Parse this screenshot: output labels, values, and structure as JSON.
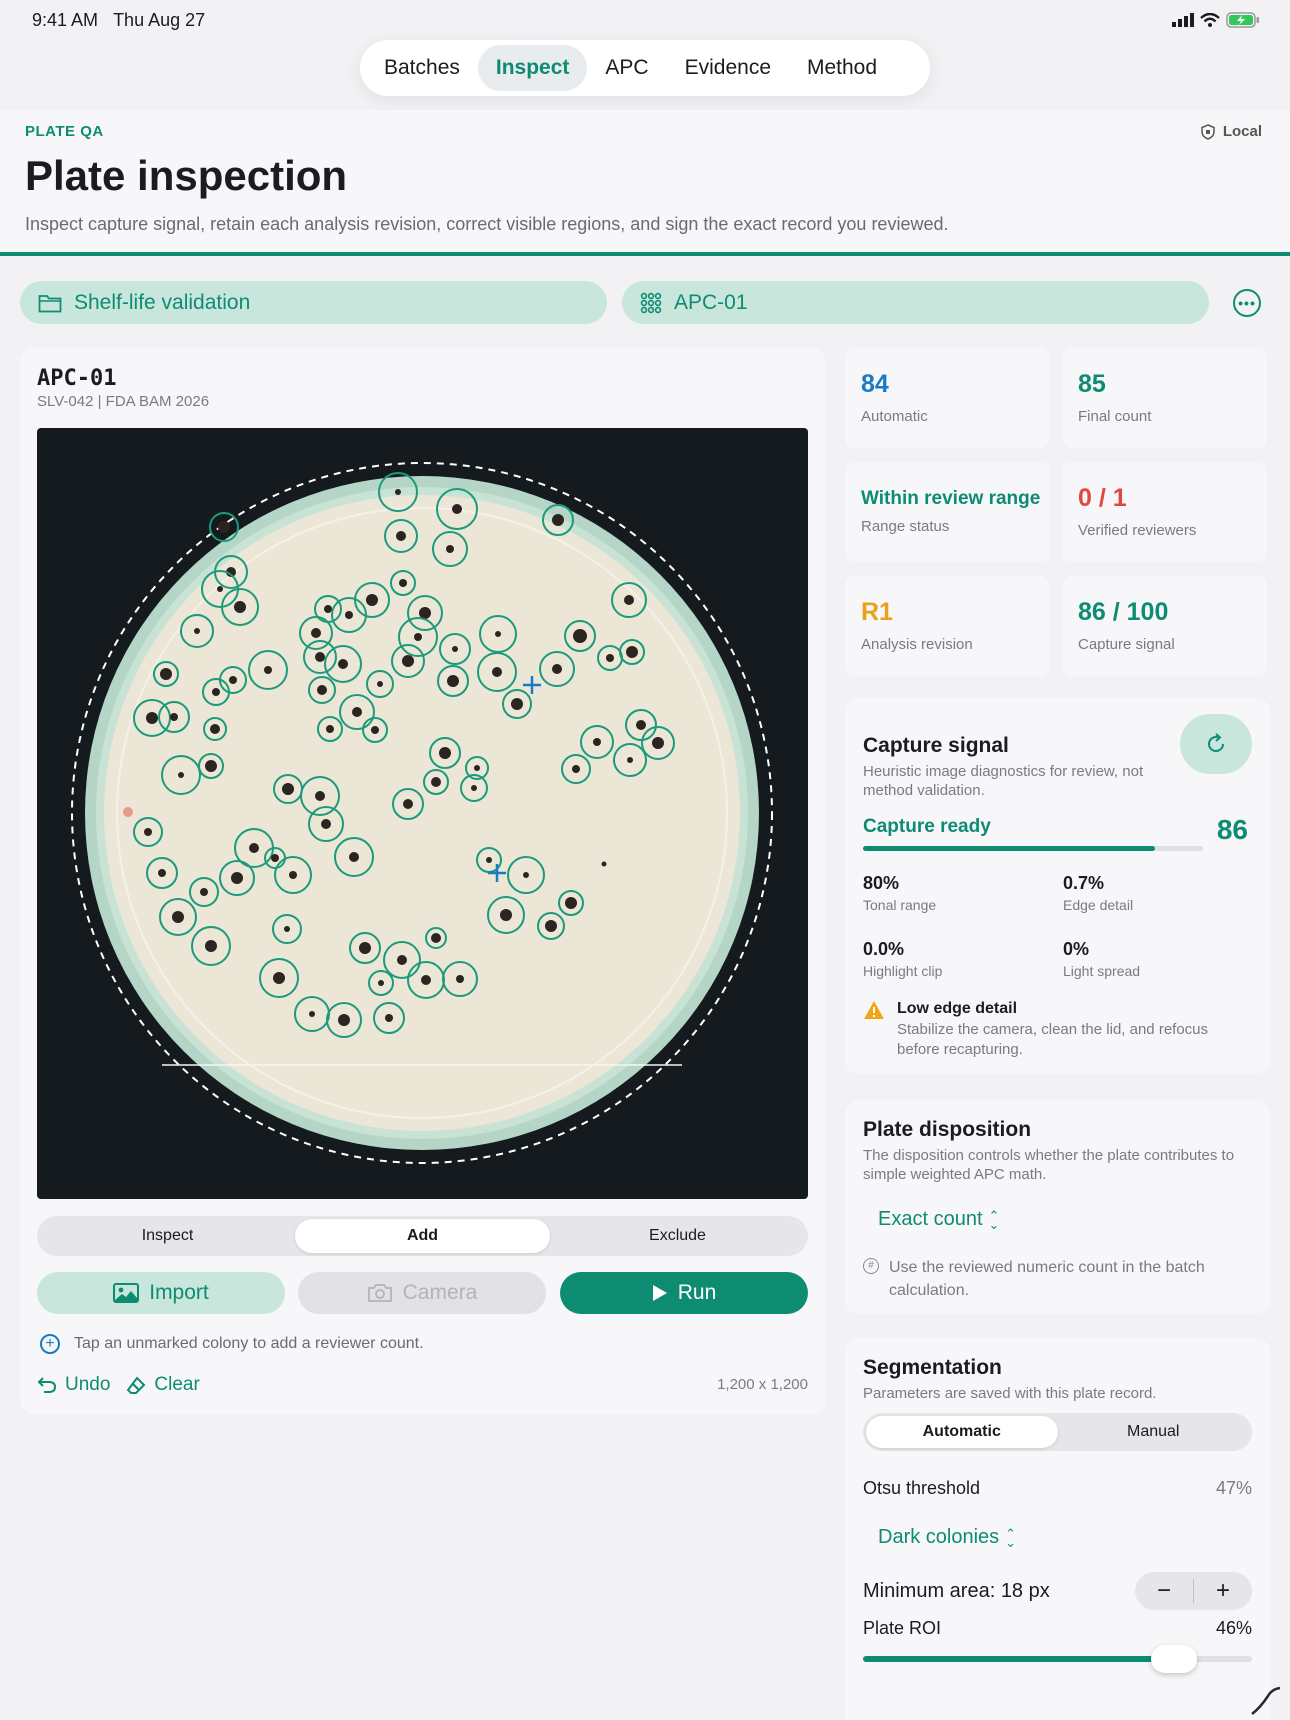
{
  "status": {
    "time": "9:41 AM",
    "date": "Thu Aug 27"
  },
  "nav": {
    "tabs": [
      {
        "label": "Batches"
      },
      {
        "label": "Inspect"
      },
      {
        "label": "APC"
      },
      {
        "label": "Evidence"
      },
      {
        "label": "Method"
      }
    ],
    "active": "Inspect"
  },
  "header": {
    "eyebrow": "PLATE QA",
    "local": "Local",
    "title": "Plate inspection",
    "subtitle": "Inspect capture signal, retain each analysis revision, correct visible regions, and sign the exact record you reviewed."
  },
  "pickers": {
    "study": "Shelf-life validation",
    "plate": "APC-01"
  },
  "plate": {
    "id": "APC-01",
    "meta": "SLV-042  |  FDA BAM 2026",
    "modes": [
      "Inspect",
      "Add",
      "Exclude"
    ],
    "active_mode": "Add",
    "buttons": {
      "import": "Import",
      "camera": "Camera",
      "run": "Run"
    },
    "hint": "Tap an unmarked colony to add a reviewer count.",
    "undo": "Undo",
    "clear": "Clear",
    "dimensions": "1,200 x 1,200"
  },
  "stats": [
    {
      "value": "84",
      "label": "Automatic",
      "color": "#1a7ac4"
    },
    {
      "value": "85",
      "label": "Final count",
      "color": "#0d8c72"
    },
    {
      "value": "Within review range",
      "label": "Range status",
      "color": "#0d8c72"
    },
    {
      "value": "0 / 1",
      "label": "Verified reviewers",
      "color": "#e0483e"
    },
    {
      "value": "R1",
      "label": "Analysis revision",
      "color": "#e8a21a"
    },
    {
      "value": "86 / 100",
      "label": "Capture signal",
      "color": "#0d8c72"
    }
  ],
  "capture": {
    "title": "Capture signal",
    "desc": "Heuristic image diagnostics for review, not method validation.",
    "status": "Capture ready",
    "score": "86",
    "progress": 0.86,
    "metrics": [
      {
        "value": "80%",
        "label": "Tonal range"
      },
      {
        "value": "0.7%",
        "label": "Edge detail"
      },
      {
        "value": "0.0%",
        "label": "Highlight clip"
      },
      {
        "value": "0%",
        "label": "Light spread"
      }
    ],
    "warning_title": "Low edge detail",
    "warning_desc": "Stabilize the camera, clean the lid, and refocus before recapturing."
  },
  "disposition": {
    "title": "Plate disposition",
    "desc": "The disposition controls whether the plate contributes to simple weighted APC math.",
    "value": "Exact count",
    "note": "Use the reviewed numeric count in the batch calculation."
  },
  "segmentation": {
    "title": "Segmentation",
    "desc": "Parameters are saved with this plate record.",
    "modes": [
      "Automatic",
      "Manual"
    ],
    "active_mode": "Automatic",
    "otsu_label": "Otsu threshold",
    "otsu_value": "47%",
    "polarity": "Dark colonies",
    "min_area": "Minimum area: 18 px",
    "roi_label": "Plate ROI",
    "roi_value": "46%",
    "roi_fraction": 0.8
  },
  "colonies": [
    [
      398,
      492,
      19,
      3
    ],
    [
      224,
      527,
      14,
      6
    ],
    [
      457,
      509,
      20,
      5
    ],
    [
      401,
      536,
      16,
      5
    ],
    [
      450,
      549,
      17,
      4
    ],
    [
      558,
      520,
      15,
      6
    ],
    [
      231,
      572,
      16,
      5
    ],
    [
      220,
      589,
      18,
      3
    ],
    [
      240,
      607,
      18,
      6
    ],
    [
      403,
      583,
      12,
      4
    ],
    [
      372,
      600,
      17,
      6
    ],
    [
      328,
      609,
      13,
      4
    ],
    [
      349,
      615,
      17,
      4
    ],
    [
      425,
      613,
      17,
      6
    ],
    [
      197,
      631,
      16,
      3
    ],
    [
      316,
      633,
      16,
      5
    ],
    [
      418,
      637,
      19,
      4
    ],
    [
      498,
      634,
      18,
      3
    ],
    [
      580,
      636,
      15,
      7
    ],
    [
      629,
      600,
      17,
      5
    ],
    [
      455,
      649,
      15,
      3
    ],
    [
      320,
      657,
      16,
      5
    ],
    [
      343,
      664,
      18,
      5
    ],
    [
      408,
      661,
      16,
      6
    ],
    [
      453,
      681,
      15,
      6
    ],
    [
      497,
      672,
      19,
      5
    ],
    [
      557,
      669,
      17,
      5
    ],
    [
      610,
      658,
      12,
      4
    ],
    [
      632,
      652,
      12,
      6
    ],
    [
      166,
      674,
      12,
      6
    ],
    [
      233,
      680,
      13,
      4
    ],
    [
      268,
      670,
      19,
      4
    ],
    [
      216,
      692,
      13,
      4
    ],
    [
      322,
      690,
      13,
      5
    ],
    [
      380,
      684,
      13,
      3
    ],
    [
      152,
      718,
      18,
      6
    ],
    [
      174,
      717,
      15,
      4
    ],
    [
      215,
      729,
      11,
      5
    ],
    [
      357,
      712,
      17,
      5
    ],
    [
      330,
      729,
      12,
      4
    ],
    [
      375,
      730,
      12,
      4
    ],
    [
      517,
      704,
      14,
      6
    ],
    [
      641,
      725,
      15,
      5
    ],
    [
      658,
      743,
      16,
      6
    ],
    [
      597,
      742,
      16,
      4
    ],
    [
      630,
      760,
      16,
      3
    ],
    [
      576,
      769,
      14,
      4
    ],
    [
      445,
      753,
      15,
      6
    ],
    [
      477,
      768,
      11,
      3
    ],
    [
      436,
      782,
      12,
      5
    ],
    [
      474,
      788,
      13,
      3
    ],
    [
      181,
      775,
      19,
      3
    ],
    [
      211,
      766,
      12,
      6
    ],
    [
      288,
      789,
      14,
      6
    ],
    [
      320,
      796,
      19,
      5
    ],
    [
      326,
      824,
      17,
      5
    ],
    [
      408,
      804,
      15,
      5
    ],
    [
      148,
      832,
      14,
      4
    ],
    [
      254,
      848,
      19,
      5
    ],
    [
      275,
      858,
      10,
      4
    ],
    [
      354,
      857,
      19,
      5
    ],
    [
      162,
      873,
      15,
      4
    ],
    [
      237,
      878,
      17,
      6
    ],
    [
      293,
      875,
      18,
      4
    ],
    [
      489,
      860,
      12,
      3
    ],
    [
      526,
      875,
      18,
      3
    ],
    [
      204,
      892,
      14,
      4
    ],
    [
      178,
      917,
      18,
      6
    ],
    [
      506,
      915,
      18,
      6
    ],
    [
      571,
      903,
      12,
      6
    ],
    [
      551,
      926,
      13,
      6
    ],
    [
      287,
      929,
      14,
      3
    ],
    [
      211,
      946,
      19,
      6
    ],
    [
      365,
      948,
      15,
      6
    ],
    [
      402,
      960,
      18,
      5
    ],
    [
      436,
      938,
      10,
      5
    ],
    [
      279,
      978,
      19,
      6
    ],
    [
      381,
      983,
      12,
      3
    ],
    [
      426,
      980,
      18,
      5
    ],
    [
      460,
      979,
      17,
      4
    ],
    [
      312,
      1014,
      17,
      3
    ],
    [
      344,
      1020,
      17,
      6
    ],
    [
      389,
      1018,
      15,
      4
    ]
  ],
  "markers": [
    [
      532,
      685
    ],
    [
      497,
      873
    ]
  ]
}
